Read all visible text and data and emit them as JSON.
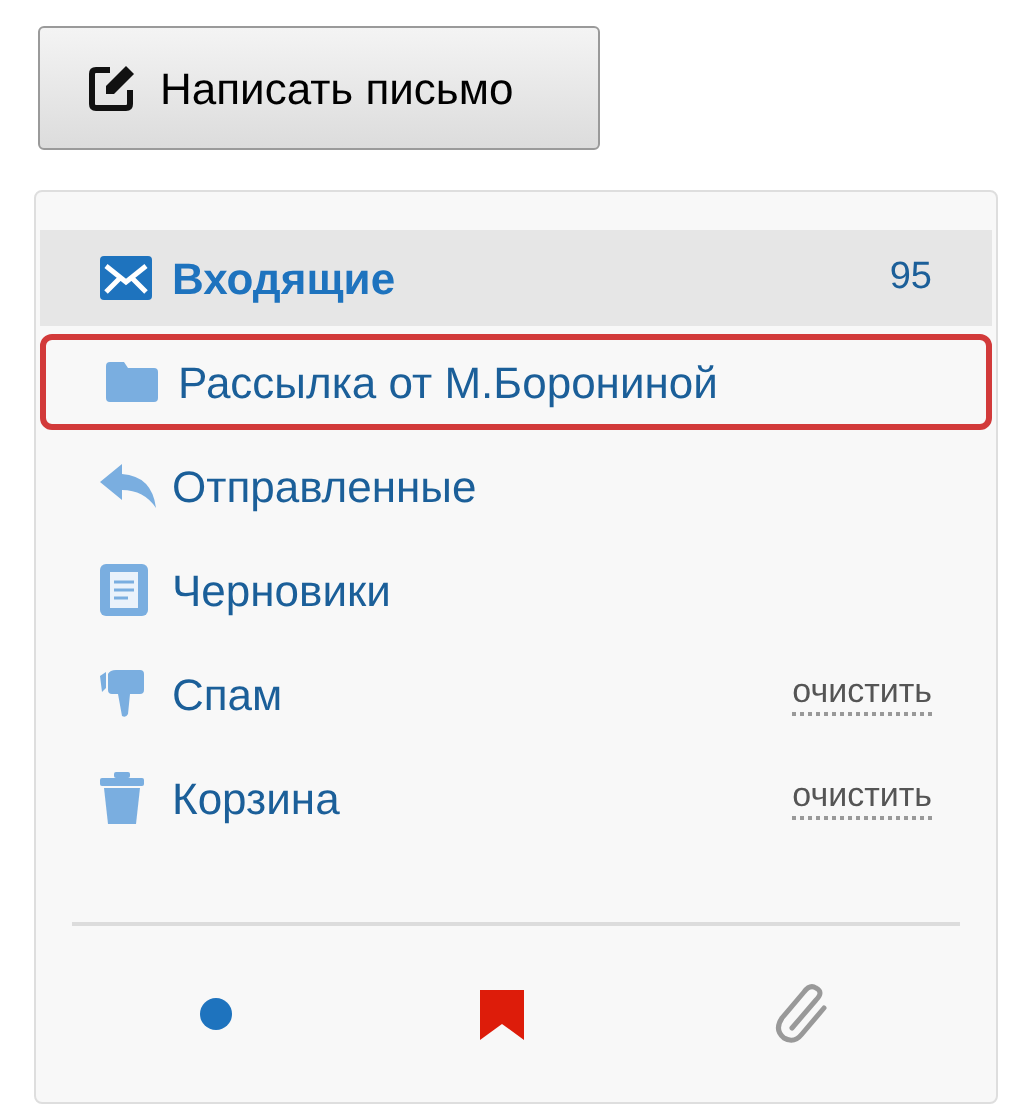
{
  "compose_button": {
    "label": "Написать письмо"
  },
  "folders": [
    {
      "kind": "inbox",
      "label": "Входящие",
      "count": "95",
      "selected": true,
      "outlined": false
    },
    {
      "kind": "folder",
      "label": "Рассылка от М.Борониной",
      "selected": false,
      "outlined": true
    },
    {
      "kind": "sent",
      "label": "Отправленные",
      "selected": false,
      "outlined": false
    },
    {
      "kind": "drafts",
      "label": "Черновики",
      "selected": false,
      "outlined": false
    },
    {
      "kind": "spam",
      "label": "Спам",
      "action": "очистить",
      "selected": false,
      "outlined": false
    },
    {
      "kind": "trash",
      "label": "Корзина",
      "action": "очистить",
      "selected": false,
      "outlined": false
    }
  ]
}
